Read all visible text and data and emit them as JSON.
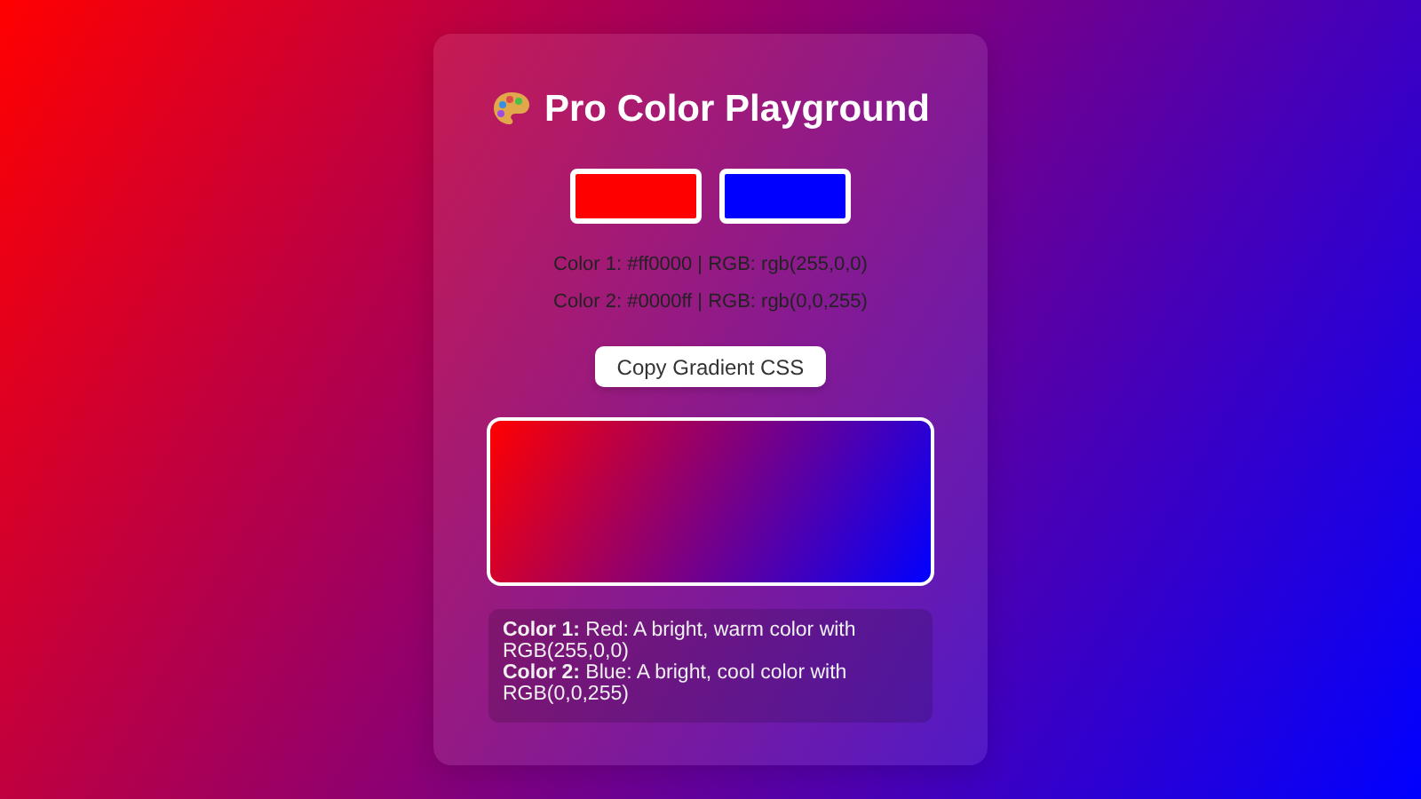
{
  "title": "Pro Color Playground",
  "colors": [
    {
      "color": "#ff0000",
      "info": "Color 1: #ff0000 | RGB: rgb(255,0,0)"
    },
    {
      "color": "#0000ff",
      "info": "Color 2: #0000ff | RGB: rgb(0,0,255)"
    }
  ],
  "copy_button": "Copy Gradient CSS",
  "descriptions": [
    "**Color 1:** Red: A bright, warm color with RGB(255,0,0)",
    "**Color 2:** Blue: A bright, cool color with RGB(0,0,255)"
  ]
}
